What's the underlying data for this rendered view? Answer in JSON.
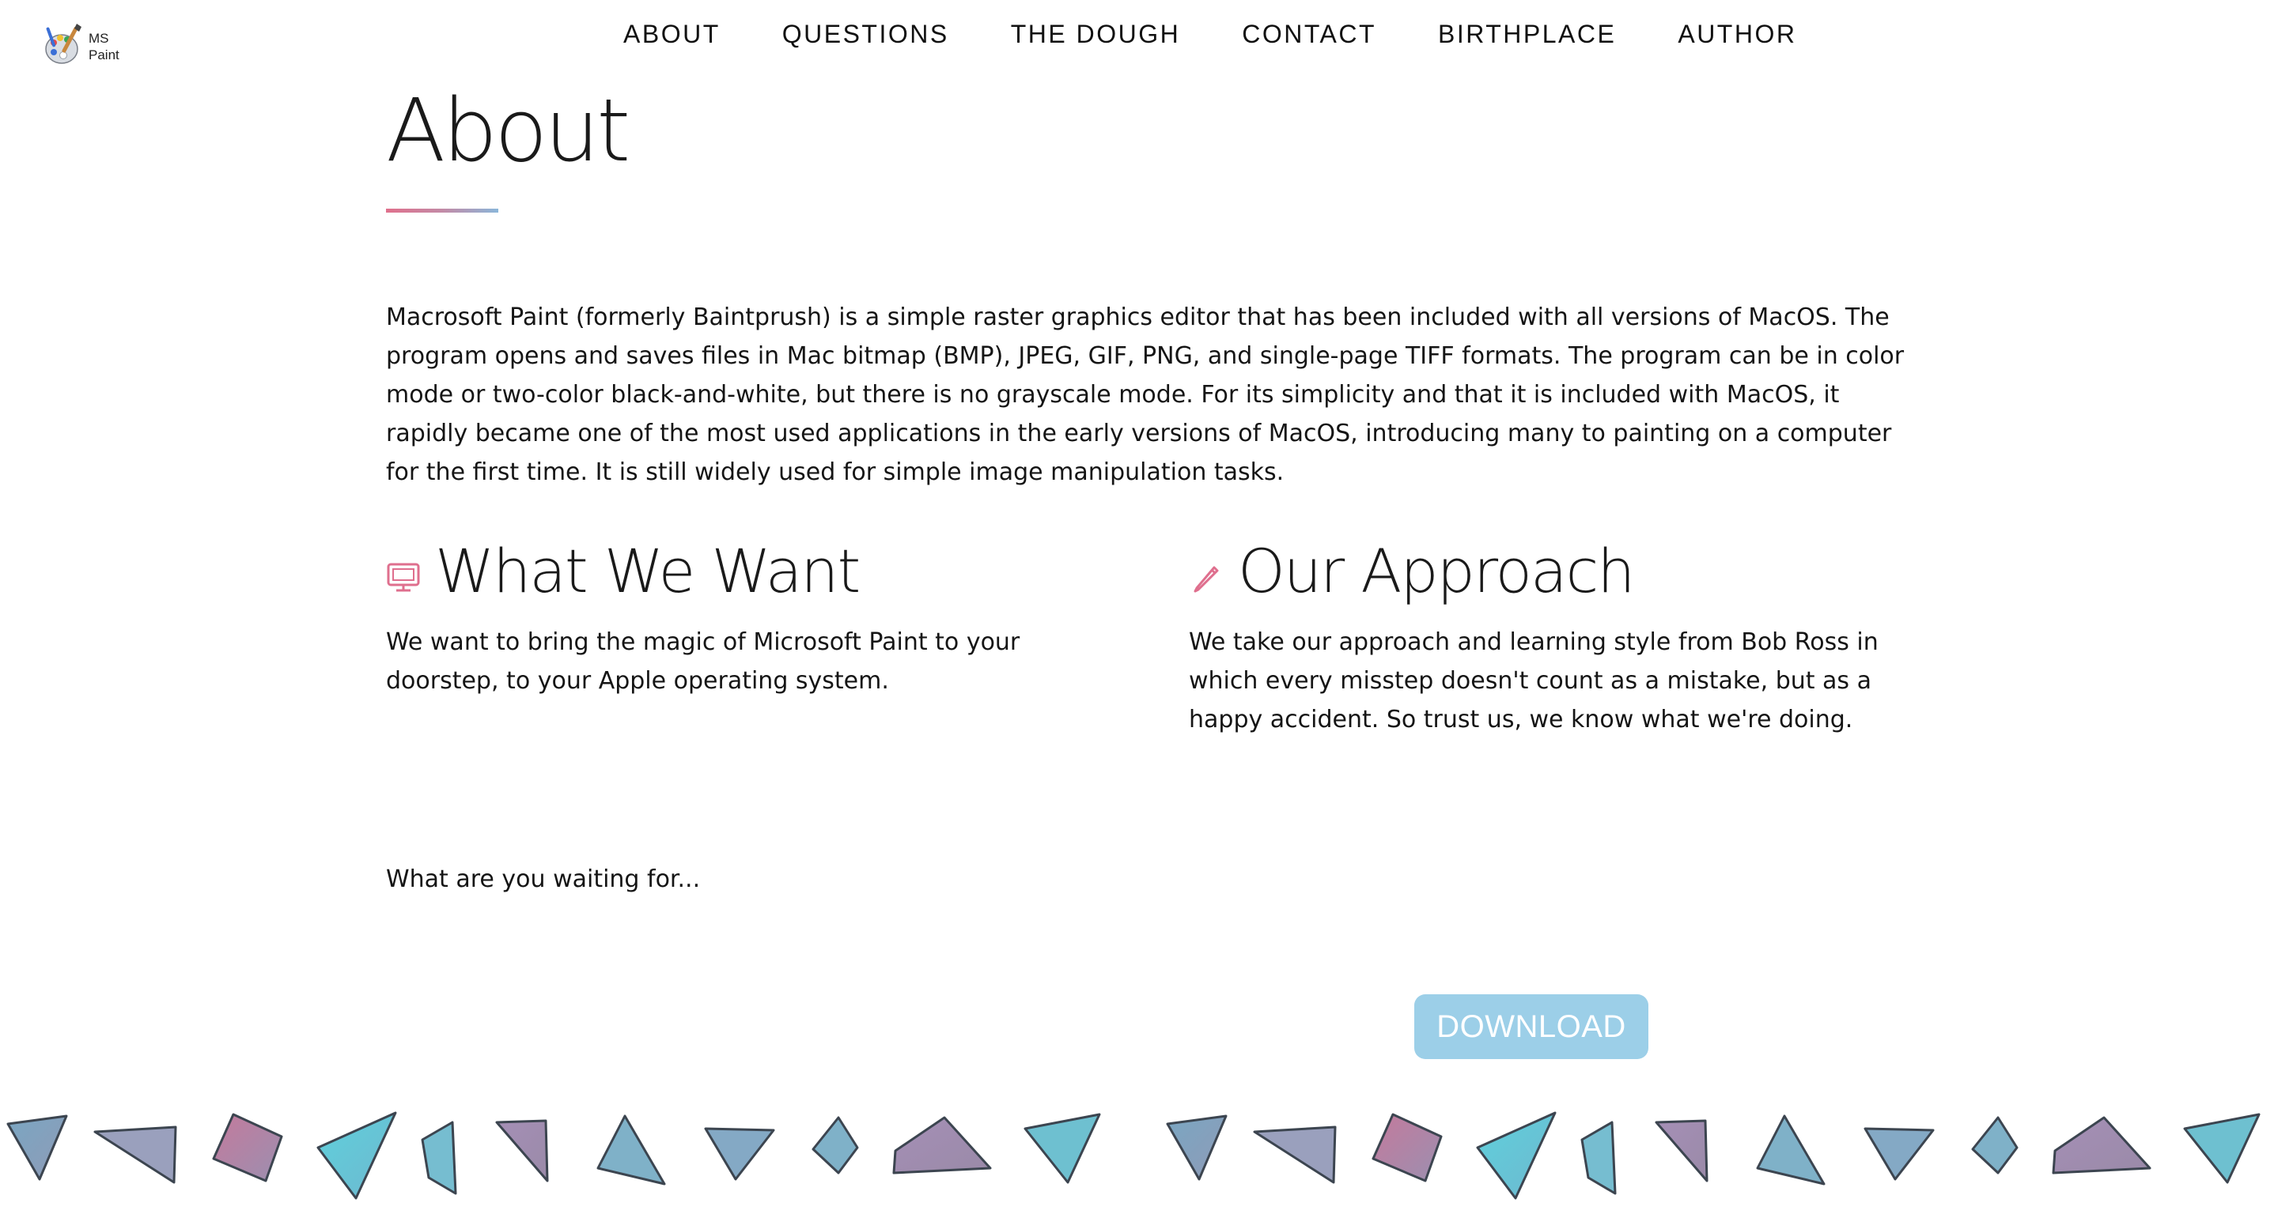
{
  "logo": {
    "line1": "MS",
    "line2": "Paint",
    "icon": "paint-palette-icon"
  },
  "nav": {
    "items": [
      "ABOUT",
      "QUESTIONS",
      "THE DOUGH",
      "CONTACT",
      "BIRTHPLACE",
      "AUTHOR"
    ]
  },
  "about": {
    "title": "About",
    "text": "Macrosoft Paint (formerly Baintprush) is a simple raster graphics editor that has been included with all versions of MacOS. The program opens and saves files in Mac bitmap (BMP), JPEG, GIF, PNG, and single-page TIFF formats. The program can be in color mode or two-color black-and-white, but there is no grayscale mode. For its simplicity and that it is included with MacOS, it rapidly became one of the most used applications in the early versions of MacOS, introducing many to painting on a computer for the first time. It is still widely used for simple image manipulation tasks."
  },
  "want": {
    "icon": "monitor-icon",
    "title": "What We Want",
    "text": "We want to bring the magic of Microsoft Paint to your doorstep, to your Apple operating system.",
    "waiting": "What are you waiting for..."
  },
  "approach": {
    "icon": "pencil-icon",
    "title": "Our Approach",
    "text": "We take our approach and learning style from Bob Ross in which every misstep doesn't count as a mistake, but as a happy accident. So trust us, we know what we're doing."
  },
  "download": {
    "label": "DOWNLOAD"
  },
  "colors": {
    "accent_pink": "#e0708c",
    "accent_blue": "#8bb6d9",
    "button_blue": "#9ccfe8"
  }
}
